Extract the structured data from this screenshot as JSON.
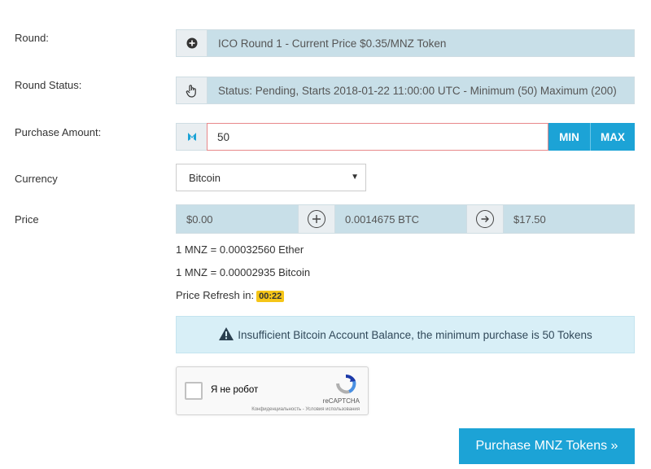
{
  "form": {
    "round_label": "Round:",
    "round_value": "ICO Round 1 - Current Price $0.35/MNZ Token",
    "status_label": "Round Status:",
    "status_value": "Status: Pending, Starts 2018-01-22 11:00:00 UTC - Minimum (50) Maximum (200)",
    "amount_label": "Purchase Amount:",
    "amount_value": "50",
    "min_label": "MIN",
    "max_label": "MAX",
    "currency_label": "Currency",
    "currency_selected": "Bitcoin",
    "price_label": "Price"
  },
  "price": {
    "usd": "$0.00",
    "btc": "0.0014675 BTC",
    "total": "$17.50"
  },
  "rates": {
    "ether": "1 MNZ = 0.00032560 Ether",
    "bitcoin": "1 MNZ = 0.00002935 Bitcoin",
    "refresh_label": "Price Refresh in:",
    "refresh_timer": "00:22"
  },
  "alert": {
    "message": "Insufficient Bitcoin Account Balance, the minimum purchase is 50 Tokens"
  },
  "captcha": {
    "label": "Я не робот",
    "brand": "reCAPTCHA",
    "terms": "Конфиденциальность - Условия использования"
  },
  "purchase_button": "Purchase MNZ Tokens »",
  "colors": {
    "accent": "#1ca3d6",
    "field_bg": "#c8dfe8",
    "alert_bg": "#d8eff7",
    "timer_bg": "#f5c518",
    "error_border": "#e8888a"
  }
}
